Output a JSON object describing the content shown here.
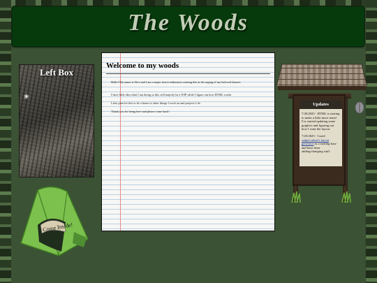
{
  "header": {
    "title": "The Woods"
  },
  "left_box": {
    "title": "Left Box"
  },
  "tent": {
    "sign_text": "Come Inside!"
  },
  "main": {
    "title": "Welcome to my woods",
    "paragraphs": [
      "Hello! My name is Alex and I am a major insect enthusiast creating this at the urging of my beloved fiancee.",
      "I have little idea what I am doing so this will majorly be a WIP while I figure out how HTML works",
      "I also plan for this to be a home to other things I work on and projects I do",
      "Thank you for being here and please come back!"
    ]
  },
  "updates": {
    "title": "Updates",
    "entries": [
      {
        "text": "7/26/2025 - HTML is starting to make a little more sense! I've started updating some graphics and figuring out how I want the layout."
      },
      {
        "prefix": "7/25/2025 - I used",
        "link": "sadgrl.online's layout generator",
        "suffix": "as a starting base and have been adding/changing stuff"
      }
    ]
  },
  "colors": {
    "header_bg": "#063a0c",
    "title_color": "#c2cdb6",
    "content_bg": "#3b5234",
    "paper_bg": "#f7f7f5",
    "link": "#1f3f9a"
  }
}
